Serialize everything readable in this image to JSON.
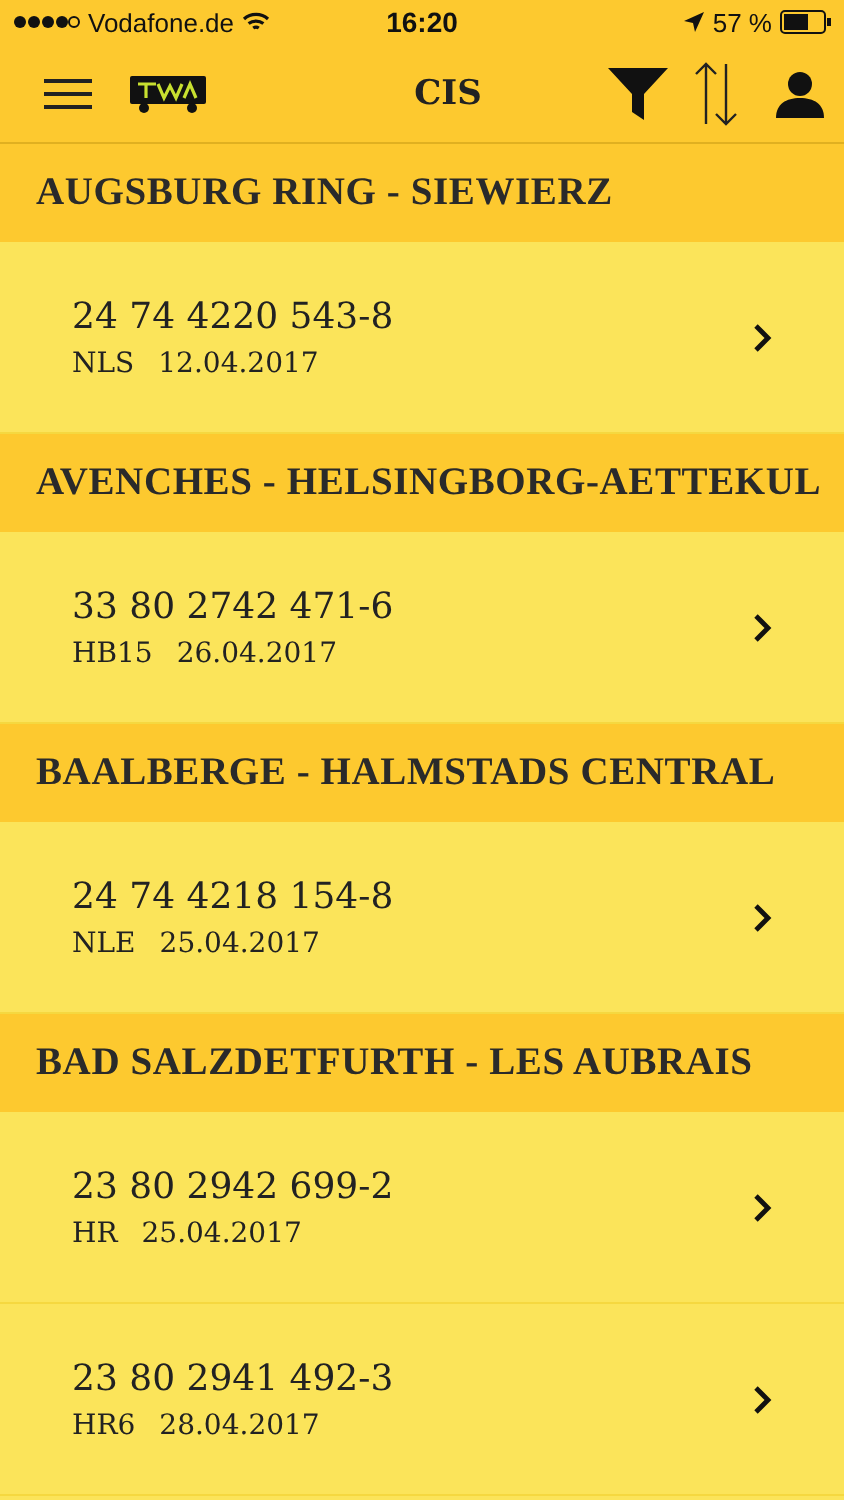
{
  "status_bar": {
    "carrier": "Vodafone.de",
    "time": "16:20",
    "battery": "57 %"
  },
  "nav_bar": {
    "title": "CIS"
  },
  "sections": [
    {
      "title": "AUGSBURG RING - SIEWIERZ",
      "items": [
        {
          "number": "24 74 4220 543-8",
          "code": "NLS",
          "date": "12.04.2017"
        }
      ]
    },
    {
      "title": "AVENCHES - HELSINGBORG-AETTEKUL",
      "items": [
        {
          "number": "33 80 2742 471-6",
          "code": "HB15",
          "date": "26.04.2017"
        }
      ]
    },
    {
      "title": "BAALBERGE - HALMSTADS CENTRAL",
      "items": [
        {
          "number": "24 74 4218 154-8",
          "code": "NLE",
          "date": "25.04.2017"
        }
      ]
    },
    {
      "title": "BAD SALZDETFURTH - LES AUBRAIS",
      "items": [
        {
          "number": "23 80 2942 699-2",
          "code": "HR",
          "date": "25.04.2017"
        },
        {
          "number": "23 80 2941 492-3",
          "code": "HR6",
          "date": "28.04.2017"
        }
      ]
    }
  ]
}
